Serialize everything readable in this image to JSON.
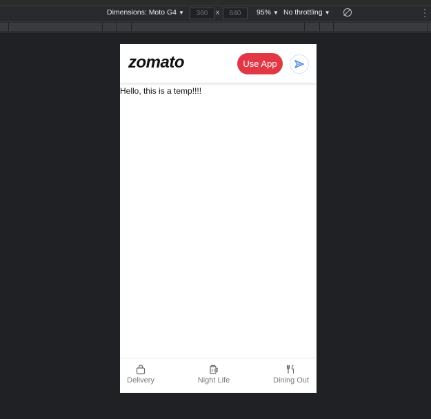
{
  "devtools": {
    "dimensions_label": "Dimensions: Moto G4",
    "width_value": "360",
    "times_symbol": "x",
    "height_value": "640",
    "zoom": "95%",
    "throttling": "No throttling"
  },
  "app": {
    "logo": "zomato",
    "use_app_label": "Use App",
    "content_text": "Hello, this is a temp!!!!",
    "colors": {
      "accent": "#e23744",
      "nav_icon": "#4a90e2"
    },
    "bottom_nav": [
      {
        "label": "Delivery",
        "icon": "shopping-bag-icon"
      },
      {
        "label": "Night Life",
        "icon": "beer-mug-icon"
      },
      {
        "label": "Dining Out",
        "icon": "dining-icon"
      }
    ]
  }
}
